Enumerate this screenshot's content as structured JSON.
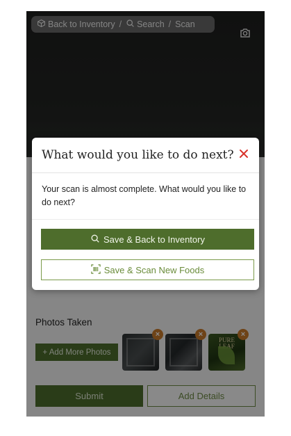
{
  "breadcrumb": {
    "back_label": "Back to Inventory",
    "sep1": "/",
    "search_label": "Search",
    "sep2": "/",
    "scan_label": "Scan"
  },
  "form": {
    "photos_label": "Photos Taken",
    "add_photos_label": "+ Add More Photos",
    "remove_label": "×",
    "submit_label": "Submit",
    "details_label": "Add Details",
    "thumb3_brand": "PURE LEAF"
  },
  "modal": {
    "title": "What would you like to do next?",
    "body": "Your scan is almost complete. What would you like to do next?",
    "primary_label": "Save & Back to Inventory",
    "secondary_label": "Save & Scan New Foods"
  },
  "colors": {
    "brand_green": "#4e6d2c",
    "close_red": "#d9332b",
    "remove_orange": "#c87a2a"
  },
  "icons": {
    "back": "box-icon",
    "search": "search-icon",
    "camera_flip": "camera-switch-icon",
    "close": "close-icon",
    "barcode": "barcode-icon"
  }
}
